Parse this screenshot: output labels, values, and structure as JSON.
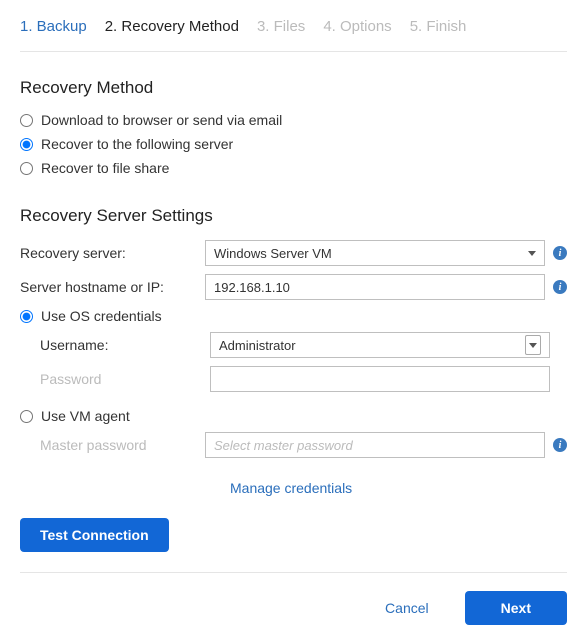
{
  "wizard": {
    "steps": [
      {
        "label": "1. Backup",
        "state": "done"
      },
      {
        "label": "2. Recovery Method",
        "state": "active"
      },
      {
        "label": "3. Files",
        "state": "pending"
      },
      {
        "label": "4. Options",
        "state": "pending"
      },
      {
        "label": "5. Finish",
        "state": "pending"
      }
    ]
  },
  "recovery_method": {
    "title": "Recovery Method",
    "options": {
      "browser": "Download to browser or send via email",
      "server": "Recover to the following server",
      "fileshare": "Recover to file share"
    },
    "selected": "server"
  },
  "server_settings": {
    "title": "Recovery Server Settings",
    "recovery_server_label": "Recovery server:",
    "recovery_server_value": "Windows Server VM",
    "hostname_label": "Server hostname or IP:",
    "hostname_value": "192.168.1.10",
    "use_os_label": "Use OS credentials",
    "username_label": "Username:",
    "username_value": "Administrator",
    "password_label": "Password",
    "password_value": "",
    "use_vm_label": "Use VM agent",
    "master_pw_label": "Master password",
    "master_pw_placeholder": "Select master password"
  },
  "links": {
    "manage_credentials": "Manage credentials"
  },
  "buttons": {
    "test_connection": "Test Connection",
    "cancel": "Cancel",
    "next": "Next"
  }
}
